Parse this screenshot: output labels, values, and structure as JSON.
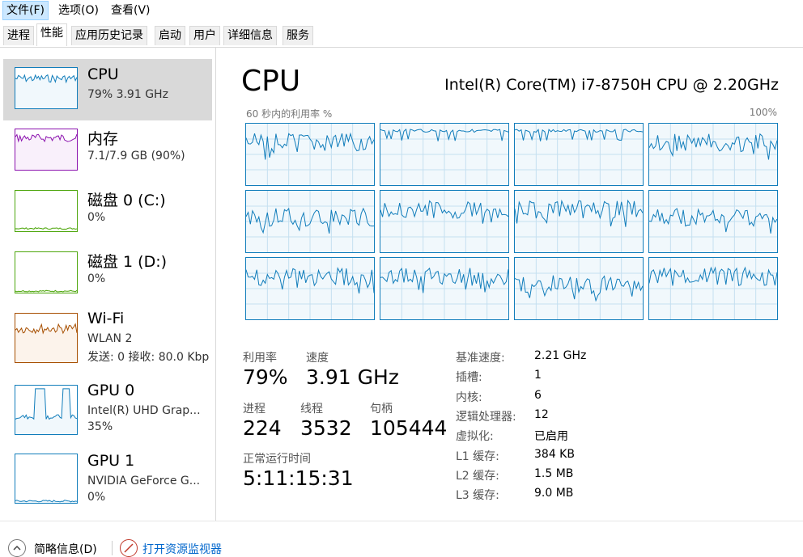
{
  "menu": [
    {
      "label": "文件(F)",
      "active": true
    },
    {
      "label": "选项(O)",
      "active": false
    },
    {
      "label": "查看(V)",
      "active": false
    }
  ],
  "tabs": [
    {
      "label": "进程",
      "active": false
    },
    {
      "label": "性能",
      "active": true
    },
    {
      "label": "应用历史记录",
      "active": false
    },
    {
      "label": "启动",
      "active": false
    },
    {
      "label": "用户",
      "active": false
    },
    {
      "label": "详细信息",
      "active": false
    },
    {
      "label": "服务",
      "active": false
    }
  ],
  "sidebar": {
    "items": [
      {
        "title": "CPU",
        "sub1": "79%  3.91 GHz",
        "sub2": "",
        "sub3": "",
        "color": "#117dbb",
        "fill": "#f1f8fc",
        "selected": true,
        "usage": 0.85
      },
      {
        "title": "内存",
        "sub1": "7.1/7.9 GB (90%)",
        "sub2": "",
        "sub3": "",
        "color": "#8b12ae",
        "fill": "#f9f0fb",
        "selected": false,
        "usage": 0.9
      },
      {
        "title": "磁盘 0 (C:)",
        "sub1": "0%",
        "sub2": "",
        "sub3": "",
        "color": "#4da60c",
        "fill": "#f6fbf0",
        "selected": false,
        "usage": 0.03
      },
      {
        "title": "磁盘 1 (D:)",
        "sub1": "0%",
        "sub2": "",
        "sub3": "",
        "color": "#4da60c",
        "fill": "#f6fbf0",
        "selected": false,
        "usage": 0.0
      },
      {
        "title": "Wi-Fi",
        "sub1": "WLAN 2",
        "sub2": "发送: 0 接收: 80.0 Kbp",
        "sub3": "",
        "color": "#a74f01",
        "fill": "#fcf3eb",
        "selected": false,
        "usage": 0.8
      },
      {
        "title": "GPU 0",
        "sub1": "Intel(R) UHD Grap...",
        "sub2": "35%",
        "sub3": "",
        "color": "#117dbb",
        "fill": "#f1f8fc",
        "selected": false,
        "usage": 0.35
      },
      {
        "title": "GPU 1",
        "sub1": "NVIDIA GeForce G...",
        "sub2": "0%",
        "sub3": "",
        "color": "#117dbb",
        "fill": "#f1f8fc",
        "selected": false,
        "usage": 0.0
      }
    ]
  },
  "main": {
    "title": "CPU",
    "model": "Intel(R) Core(TM) i7-8750H CPU @ 2.20GHz",
    "chart_label": "60 秒内的利用率 %",
    "chart_max": "100%",
    "core_count": 12,
    "line_color": "#117dbb",
    "grid_color": "#c5dff0"
  },
  "stats": {
    "util_label": "利用率",
    "util_value": "79%",
    "speed_label": "速度",
    "speed_value": "3.91 GHz",
    "proc_label": "进程",
    "proc_value": "224",
    "thread_label": "线程",
    "thread_value": "3532",
    "handle_label": "句柄",
    "handle_value": "105444",
    "uptime_label": "正常运行时间",
    "uptime_value": "5:11:15:31"
  },
  "details": [
    {
      "key": "基准速度:",
      "value": "2.21 GHz"
    },
    {
      "key": "插槽:",
      "value": "1"
    },
    {
      "key": "内核:",
      "value": "6"
    },
    {
      "key": "逻辑处理器:",
      "value": "12"
    },
    {
      "key": "虚拟化:",
      "value": "已启用"
    },
    {
      "key": "L1 缓存:",
      "value": "384 KB"
    },
    {
      "key": "L2 缓存:",
      "value": "1.5 MB"
    },
    {
      "key": "L3 缓存:",
      "value": "9.0 MB"
    }
  ],
  "footer": {
    "brief_label": "简略信息(D)",
    "monitor_label": "打开资源监视器"
  }
}
